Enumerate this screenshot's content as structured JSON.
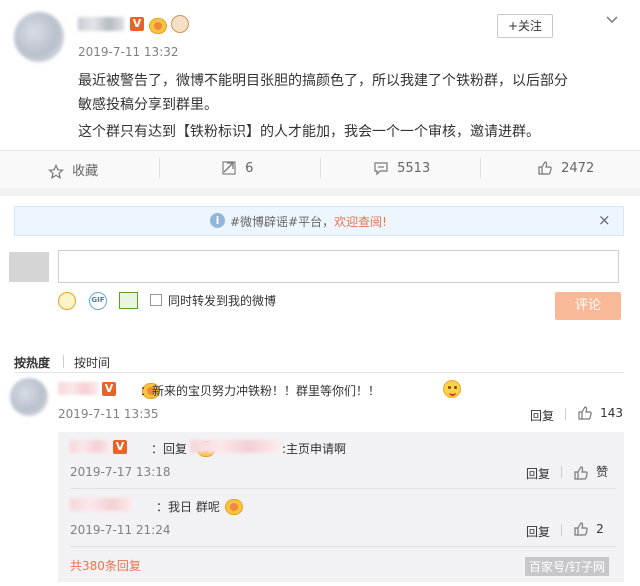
{
  "post": {
    "time": "2019-7-11 13:32",
    "follow_label": "+关注",
    "text_line1": "最近被警告了，微博不能明目张胆的搞颜色了，所以我建了个铁粉群，以后部分",
    "text_line2": "敏感投稿分享到群里。",
    "text_line3": "这个群只有达到【铁粉标识】的人才能加，我会一个一个审核，邀请进群。",
    "v_badge": "V"
  },
  "actions": {
    "favorite_label": "收藏",
    "repost_count": "6",
    "comment_count": "5513",
    "like_count": "2472"
  },
  "notice": {
    "prefix": "#微博辟谣#平台，",
    "link": "欢迎查阅!",
    "close": "×"
  },
  "composer": {
    "checkbox_label": "同时转发到我的微博",
    "submit_label": "评论",
    "gif_label": "GIF"
  },
  "sort": {
    "by_hot": "按热度",
    "by_time": "按时间"
  },
  "comments": [
    {
      "text": "：新来的宝贝努力冲铁粉！！群里等你们！！",
      "time": "2019-7-11 13:35",
      "reply_label": "回复",
      "like_count": "143",
      "v_badge": "V"
    }
  ],
  "replies": [
    {
      "prefix": "：回复",
      "suffix": ":主页申请啊",
      "time": "2019-7-17 13:18",
      "reply_label": "回复",
      "like_label": "赞",
      "v_badge": "V"
    },
    {
      "text": "：我日  群呢",
      "time": "2019-7-11 21:24",
      "reply_label": "回复",
      "like_count": "2"
    }
  ],
  "more_replies": "共380条回复",
  "watermark": "百家号/钉子网",
  "colors": {
    "accent": "#eb7350",
    "link_blue": "#eb7350",
    "notice_bg": "#eef6fd",
    "button_disabled": "#f9b996"
  }
}
